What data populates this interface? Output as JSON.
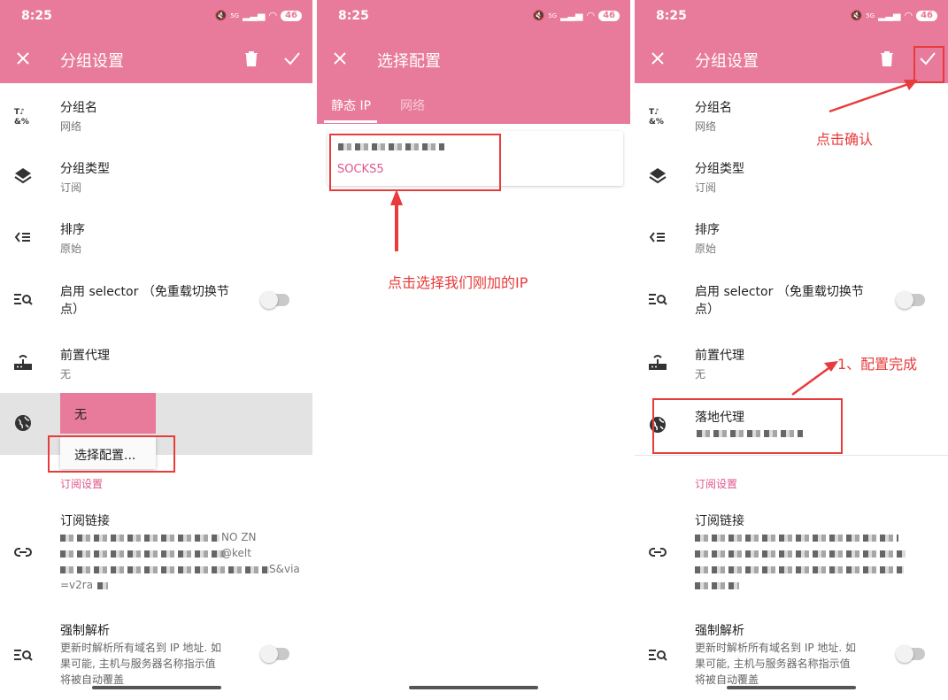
{
  "status": {
    "time": "8:25",
    "net": "5G",
    "battery": "46"
  },
  "colors": {
    "accent": "#e87a9b",
    "annotation": "#e83b3b",
    "section": "#e2548a"
  },
  "panel1": {
    "title": "分组设置",
    "rows": {
      "group_name": {
        "label": "分组名",
        "value": "网络",
        "icon": "text-format-icon"
      },
      "group_type": {
        "label": "分组类型",
        "value": "订阅",
        "icon": "layers-icon"
      },
      "sort": {
        "label": "排序",
        "value": "原始",
        "icon": "sort-icon"
      },
      "selector": {
        "label_line1": "启用 selector （免重载切换节",
        "label_line2": "点）",
        "icon": "search-list-icon",
        "toggle": false
      },
      "front_proxy": {
        "label": "前置代理",
        "value": "无",
        "icon": "router-icon"
      },
      "landing_proxy": {
        "icon": "globe-icon"
      }
    },
    "dropdown": {
      "option_none": "无",
      "option_select": "选择配置..."
    },
    "section": "订阅设置",
    "sub_link": {
      "label": "订阅链接",
      "visible_tail": "NO ZN",
      "visible_tail2": "@kelt",
      "visible_tail3": "S&via",
      "visible_tail4": "=v2ra"
    },
    "force_resolve": {
      "label": "强制解析",
      "desc_line1": "更新时解析所有域名到 IP 地址. 如",
      "desc_line2": "果可能, 主机与服务器名称指示值",
      "desc_line3": "将被自动覆盖",
      "toggle": false
    }
  },
  "panel2": {
    "title": "选择配置",
    "tabs": [
      "静态 IP",
      "网络"
    ],
    "card": {
      "protocol": "SOCKS5"
    },
    "annotation": "点击选择我们刚加的IP"
  },
  "panel3": {
    "title": "分组设置",
    "annotation_confirm": "点击确认",
    "annotation_done": "1、配置完成",
    "landing_proxy": {
      "label": "落地代理"
    }
  }
}
